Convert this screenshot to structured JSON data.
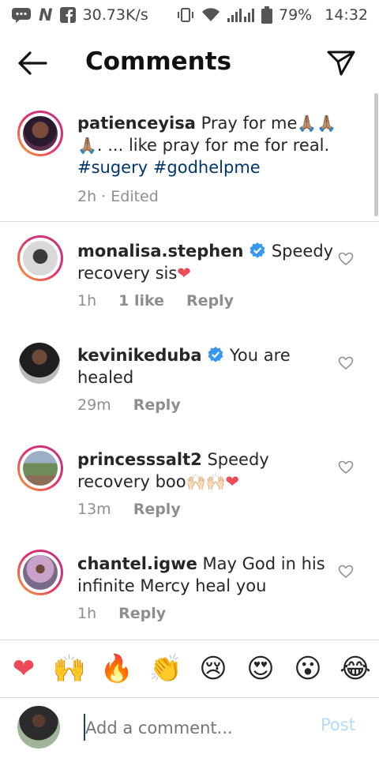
{
  "status_bar": {
    "net_speed": "30.73K/s",
    "battery": "79%",
    "time": "14:32"
  },
  "header": {
    "title": "Comments"
  },
  "caption": {
    "username": "patienceyisa",
    "text_line1": "Pray for me",
    "text_line2": ". ... like pray for me for real.",
    "hashtags": "#sugery #godhelpme",
    "meta": "2h · Edited"
  },
  "comments": [
    {
      "username": "monalisa.stephen",
      "verified": true,
      "text1": "Speedy",
      "text2": "recovery sis",
      "time": "1h",
      "likes": "1 like",
      "reply": "Reply"
    },
    {
      "username": "kevinikeduba",
      "verified": true,
      "text1": "You are",
      "text2": "healed",
      "time": "29m",
      "reply": "Reply"
    },
    {
      "username": "princesssalt2",
      "verified": false,
      "text1": "Speedy",
      "text2": "recovery boo",
      "time": "13m",
      "reply": "Reply"
    },
    {
      "username": "chantel.igwe",
      "verified": false,
      "text1": "May God in his",
      "text2": "infinite Mercy heal you",
      "time": "1h",
      "reply": "Reply"
    }
  ],
  "emoji_bar": [
    "❤",
    "🙌",
    "🔥",
    "👏",
    "😢",
    "😍",
    "😮",
    "😂"
  ],
  "composer": {
    "placeholder": "Add a comment...",
    "post_label": "Post"
  },
  "colors": {
    "verified": "#3897f0",
    "heart": "#ed4956",
    "link": "#00376b",
    "post_disabled": "#b3dbff"
  }
}
